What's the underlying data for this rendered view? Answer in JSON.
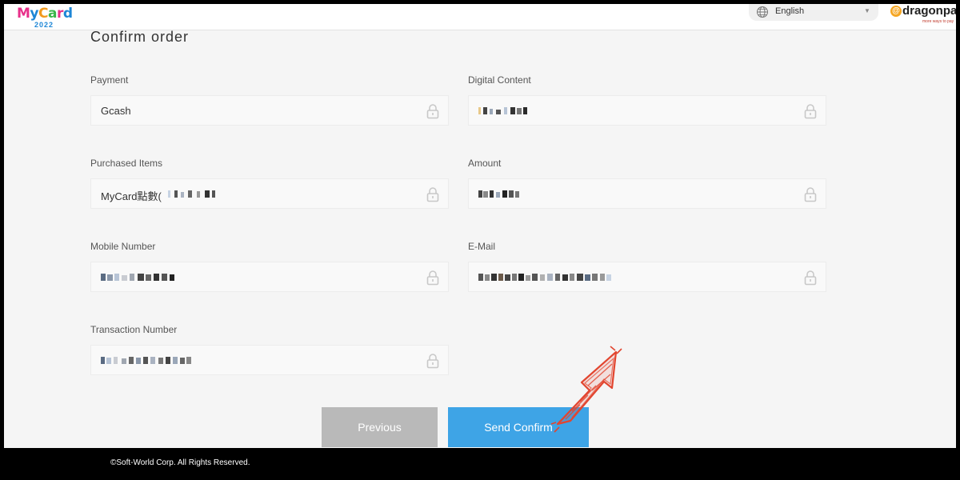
{
  "header": {
    "logo": {
      "text": "MyCard",
      "year": "2022"
    },
    "language": {
      "label": "English",
      "icon": "globe-icon",
      "caret_icon": "caret-down-icon"
    },
    "partner_logo": {
      "text": "dragonpay",
      "tagline": "more ways to pay"
    }
  },
  "page": {
    "title": "Confirm order"
  },
  "fields": {
    "payment": {
      "label": "Payment",
      "value": "Gcash"
    },
    "digital_content": {
      "label": "Digital Content",
      "value": ""
    },
    "purchased_items": {
      "label": "Purchased Items",
      "value": "MyCard點數("
    },
    "amount": {
      "label": "Amount",
      "value": ""
    },
    "mobile_number": {
      "label": "Mobile Number",
      "value": ""
    },
    "email": {
      "label": "E-Mail",
      "value": ""
    },
    "transaction_number": {
      "label": "Transaction Number",
      "value": ""
    }
  },
  "buttons": {
    "previous": "Previous",
    "send_confirm": "Send Confirm"
  },
  "footer": {
    "copyright": "©Soft-World Corp. All Rights Reserved."
  },
  "colors": {
    "send_button": "#3ea4e6",
    "previous_button": "#b9b9b9",
    "annotation_arrow": "#e2452f",
    "page_background": "#f5f5f5"
  }
}
